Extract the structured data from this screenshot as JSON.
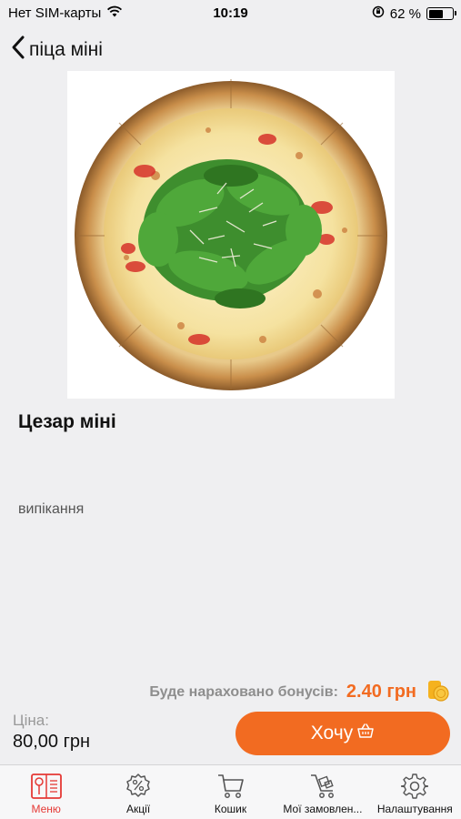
{
  "status_bar": {
    "carrier": "Нет SIM-карты",
    "time": "10:19",
    "battery": "62 %",
    "battery_level": 0.62,
    "icons": [
      "wifi-icon",
      "rotation-lock-icon",
      "battery-icon"
    ]
  },
  "nav": {
    "title": "піца  міні",
    "back_icon": "chevron-left-icon"
  },
  "product": {
    "image": "pizza-photo",
    "name": "Цезар міні",
    "description": "випікання"
  },
  "bonus": {
    "label": "Буде нараховано бонусів:",
    "value": "2.40 грн",
    "icon": "coins-icon"
  },
  "price": {
    "label": "Ціна:",
    "value": "80,00 грн"
  },
  "order_button": {
    "label": "Хочу",
    "icon": "basket-icon"
  },
  "tabs": [
    {
      "label": "Меню",
      "icon": "menu-book-icon",
      "active": true
    },
    {
      "label": "Акції",
      "icon": "percent-badge-icon",
      "active": false
    },
    {
      "label": "Кошик",
      "icon": "cart-icon",
      "active": false
    },
    {
      "label": "Мої замовлен...",
      "icon": "delivery-cart-icon",
      "active": false
    },
    {
      "label": "Налаштування",
      "icon": "gear-icon",
      "active": false
    }
  ],
  "colors": {
    "accent": "#f26b21",
    "active_tab": "#e53935",
    "background": "#efeff1"
  }
}
